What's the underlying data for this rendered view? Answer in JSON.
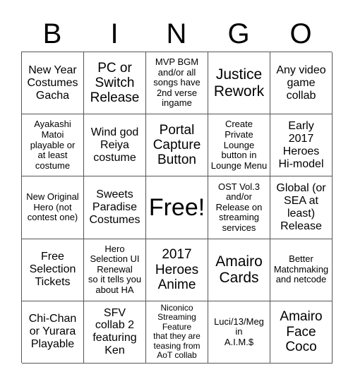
{
  "header": [
    "B",
    "I",
    "N",
    "G",
    "O"
  ],
  "cells": [
    {
      "text": "New Year\nCostumes\nGacha",
      "size": "md"
    },
    {
      "text": "PC or\nSwitch\nRelease",
      "size": "lg"
    },
    {
      "text": "MVP BGM\nand/or all\nsongs have\n2nd verse\ningame",
      "size": "sm"
    },
    {
      "text": "Justice\nRework",
      "size": "xl"
    },
    {
      "text": "Any video\ngame\ncollab",
      "size": "md"
    },
    {
      "text": "Ayakashi\nMatoi\nplayable or\nat least\ncostume",
      "size": "sm"
    },
    {
      "text": "Wind god\nReiya\ncostume",
      "size": "md"
    },
    {
      "text": "Portal\nCapture\nButton",
      "size": "lg"
    },
    {
      "text": "Create\nPrivate\nLounge\nbutton in\nLounge Menu",
      "size": "sm"
    },
    {
      "text": "Early\n2017\nHeroes\nHi-model",
      "size": "md"
    },
    {
      "text": "New Original\nHero (not\ncontest one)",
      "size": "sm"
    },
    {
      "text": "Sweets\nParadise\nCostumes",
      "size": "md"
    },
    {
      "text": "Free!",
      "size": "free"
    },
    {
      "text": "OST Vol.3\nand/or\nRelease on\nstreaming\nservices",
      "size": "sm"
    },
    {
      "text": "Global (or\nSEA at\nleast)\nRelease",
      "size": "md"
    },
    {
      "text": "Free\nSelection\nTickets",
      "size": "md"
    },
    {
      "text": "Hero\nSelection UI\nRenewal\nso it tells you\nabout HA",
      "size": "sm"
    },
    {
      "text": "2017\nHeroes\nAnime",
      "size": "lg"
    },
    {
      "text": "Amairo\nCards",
      "size": "xl"
    },
    {
      "text": "Better\nMatchmaking\nand netcode",
      "size": "sm"
    },
    {
      "text": "Chi-Chan\nor Yurara\nPlayable",
      "size": "md"
    },
    {
      "text": "SFV\ncollab 2\nfeaturing\nKen",
      "size": "md"
    },
    {
      "text": "Niconico\nStreaming\nFeature\nthat they are\nteasing from\nAoT collab",
      "size": "xs"
    },
    {
      "text": "Luci/13/Meg\nin\nA.I.M.$",
      "size": "sm"
    },
    {
      "text": "Amairo\nFace\nCoco",
      "size": "lg"
    }
  ]
}
